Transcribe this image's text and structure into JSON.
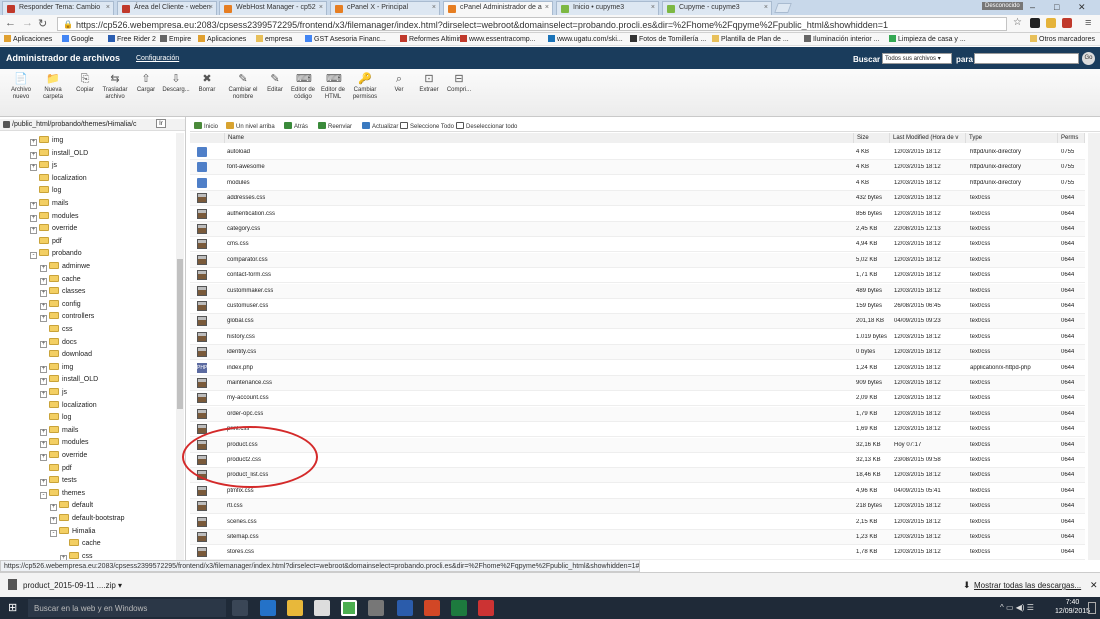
{
  "browser": {
    "tabs": [
      {
        "label": "Responder Tema: Cambio",
        "color": "#c0392b"
      },
      {
        "label": "Área del Cliente - weben",
        "color": "#c0392b"
      },
      {
        "label": "WebHost Manager - cp52",
        "color": "#e67e22"
      },
      {
        "label": "cPanel X - Principal",
        "color": "#e67e22"
      },
      {
        "label": "cPanel Administrador de a",
        "color": "#e67e22"
      },
      {
        "label": "Inicio • cupyme3",
        "color": "#7db843"
      },
      {
        "label": "Cupyme - cupyme3",
        "color": "#7db843"
      }
    ],
    "profile": "Desconocido",
    "url": "https://cp526.webempresa.eu:2083/cpsess2399572295/frontend/x3/filemanager/index.html?dirselect=webroot&domainselect=probando.procli.es&dir=%2Fhome%2Fqpyme%2Fpublic_html&showhidden=1",
    "bookmarks": [
      "Aplicaciones",
      "Google",
      "Free Rider 2",
      "Empire",
      "Aplicaciones",
      "empresa",
      "GST Asesoria Financ...",
      "Reformes Altimira",
      "www.essentracomp...",
      "www.ugatu.com/ski...",
      "Fotos de Tornillería ...",
      "Plantilla de Plan de ...",
      "Iluminación interior ...",
      "Limpieza de casa y ..."
    ],
    "other_bookmarks": "Otros marcadores"
  },
  "fm": {
    "title": "Administrador de archivos",
    "config": "Configuración",
    "search_label": "Buscar",
    "search_scope": "Todos sus archivos",
    "for_label": "para",
    "go": "Go",
    "toolbar": [
      "Archivo nuevo",
      "Nueva carpeta",
      "Copiar",
      "Trasladar archivo",
      "Cargar",
      "Descarg...",
      "Borrar",
      "Cambiar el nombre",
      "Editar",
      "Editor de código",
      "Editor de HTML",
      "Cambiar permisos",
      "Ver",
      "Extraer",
      "Compri..."
    ],
    "path": "/public_html/probando/themes/Himalia/c",
    "path_go": "Ir",
    "nav": [
      "Inicio",
      "Un nivel arriba",
      "Atrás",
      "Reenviar",
      "Actualizar",
      "Seleccione Todo",
      "Deseleccionar todo"
    ],
    "tree": [
      {
        "label": "img",
        "indent": 0,
        "pm": "+"
      },
      {
        "label": "install_OLD",
        "indent": 0,
        "pm": "+"
      },
      {
        "label": "js",
        "indent": 0,
        "pm": "+"
      },
      {
        "label": "localization",
        "indent": 0,
        "pm": ""
      },
      {
        "label": "log",
        "indent": 0,
        "pm": ""
      },
      {
        "label": "mails",
        "indent": 0,
        "pm": "+"
      },
      {
        "label": "modules",
        "indent": 0,
        "pm": "+"
      },
      {
        "label": "override",
        "indent": 0,
        "pm": "+"
      },
      {
        "label": "pdf",
        "indent": 0,
        "pm": ""
      },
      {
        "label": "probando",
        "indent": 0,
        "pm": "-"
      },
      {
        "label": "adminwe",
        "indent": 1,
        "pm": "+"
      },
      {
        "label": "cache",
        "indent": 1,
        "pm": "+"
      },
      {
        "label": "classes",
        "indent": 1,
        "pm": "+"
      },
      {
        "label": "config",
        "indent": 1,
        "pm": "+"
      },
      {
        "label": "controllers",
        "indent": 1,
        "pm": "+"
      },
      {
        "label": "css",
        "indent": 1,
        "pm": ""
      },
      {
        "label": "docs",
        "indent": 1,
        "pm": "+"
      },
      {
        "label": "download",
        "indent": 1,
        "pm": ""
      },
      {
        "label": "img",
        "indent": 1,
        "pm": "+"
      },
      {
        "label": "install_OLD",
        "indent": 1,
        "pm": "+"
      },
      {
        "label": "js",
        "indent": 1,
        "pm": "+"
      },
      {
        "label": "localization",
        "indent": 1,
        "pm": ""
      },
      {
        "label": "log",
        "indent": 1,
        "pm": ""
      },
      {
        "label": "mails",
        "indent": 1,
        "pm": "+"
      },
      {
        "label": "modules",
        "indent": 1,
        "pm": "+"
      },
      {
        "label": "override",
        "indent": 1,
        "pm": "+"
      },
      {
        "label": "pdf",
        "indent": 1,
        "pm": ""
      },
      {
        "label": "tests",
        "indent": 1,
        "pm": "+"
      },
      {
        "label": "themes",
        "indent": 1,
        "pm": "-"
      },
      {
        "label": "default",
        "indent": 2,
        "pm": "+"
      },
      {
        "label": "default-bootstrap",
        "indent": 2,
        "pm": "+"
      },
      {
        "label": "Himalia",
        "indent": 2,
        "pm": "-"
      },
      {
        "label": "cache",
        "indent": 3,
        "pm": ""
      },
      {
        "label": "css",
        "indent": 3,
        "pm": "+"
      }
    ],
    "columns": [
      "Name",
      "Size",
      "Last Modified (Hora de v",
      "Type",
      "Perms"
    ],
    "files": [
      {
        "icon": "dir",
        "name": "autoload",
        "size": "4 KB",
        "modified": "12/03/2015 18:12",
        "type": "httpd/unix-directory",
        "perms": "0755"
      },
      {
        "icon": "dir",
        "name": "font-awesome",
        "size": "4 KB",
        "modified": "12/03/2015 18:12",
        "type": "httpd/unix-directory",
        "perms": "0755"
      },
      {
        "icon": "dir",
        "name": "modules",
        "size": "4 KB",
        "modified": "12/03/2015 18:12",
        "type": "httpd/unix-directory",
        "perms": "0755"
      },
      {
        "icon": "css",
        "name": "addresses.css",
        "size": "432 bytes",
        "modified": "12/03/2015 18:12",
        "type": "text/css",
        "perms": "0644"
      },
      {
        "icon": "css",
        "name": "authentication.css",
        "size": "856 bytes",
        "modified": "12/03/2015 18:12",
        "type": "text/css",
        "perms": "0644"
      },
      {
        "icon": "css",
        "name": "category.css",
        "size": "2,45 KB",
        "modified": "22/08/2015 12:13",
        "type": "text/css",
        "perms": "0644"
      },
      {
        "icon": "css",
        "name": "cms.css",
        "size": "4,94 KB",
        "modified": "12/03/2015 18:12",
        "type": "text/css",
        "perms": "0644"
      },
      {
        "icon": "css",
        "name": "comparator.css",
        "size": "5,02 KB",
        "modified": "12/03/2015 18:12",
        "type": "text/css",
        "perms": "0644"
      },
      {
        "icon": "css",
        "name": "contact-form.css",
        "size": "1,71 KB",
        "modified": "12/03/2015 18:12",
        "type": "text/css",
        "perms": "0644"
      },
      {
        "icon": "css",
        "name": "custommaker.css",
        "size": "489 bytes",
        "modified": "12/03/2015 18:12",
        "type": "text/css",
        "perms": "0644"
      },
      {
        "icon": "css",
        "name": "customuser.css",
        "size": "159 bytes",
        "modified": "26/08/2015 06:45",
        "type": "text/css",
        "perms": "0644"
      },
      {
        "icon": "css",
        "name": "global.css",
        "size": "201,18 KB",
        "modified": "04/09/2015 09:23",
        "type": "text/css",
        "perms": "0644"
      },
      {
        "icon": "css",
        "name": "history.css",
        "size": "1.019 bytes",
        "modified": "12/03/2015 18:12",
        "type": "text/css",
        "perms": "0644"
      },
      {
        "icon": "css",
        "name": "identity.css",
        "size": "0 bytes",
        "modified": "12/03/2015 18:12",
        "type": "text/css",
        "perms": "0644"
      },
      {
        "icon": "php",
        "name": "index.php",
        "size": "1,24 KB",
        "modified": "12/03/2015 18:12",
        "type": "application/x-httpd-php",
        "perms": "0644"
      },
      {
        "icon": "css",
        "name": "maintenance.css",
        "size": "909 bytes",
        "modified": "12/03/2015 18:12",
        "type": "text/css",
        "perms": "0644"
      },
      {
        "icon": "css",
        "name": "my-account.css",
        "size": "2,09 KB",
        "modified": "12/03/2015 18:12",
        "type": "text/css",
        "perms": "0644"
      },
      {
        "icon": "css",
        "name": "order-opc.css",
        "size": "1,79 KB",
        "modified": "12/03/2015 18:12",
        "type": "text/css",
        "perms": "0644"
      },
      {
        "icon": "css",
        "name": "print.css",
        "size": "1,69 KB",
        "modified": "12/03/2015 18:12",
        "type": "text/css",
        "perms": "0644"
      },
      {
        "icon": "css",
        "name": "product.css",
        "size": "32,16 KB",
        "modified": "Hoy 07:17",
        "type": "text/css",
        "perms": "0644"
      },
      {
        "icon": "css",
        "name": "product2.css",
        "size": "32,13 KB",
        "modified": "23/08/2015 09:58",
        "type": "text/css",
        "perms": "0644"
      },
      {
        "icon": "css",
        "name": "product_list.css",
        "size": "18,46 KB",
        "modified": "12/03/2015 18:12",
        "type": "text/css",
        "perms": "0644"
      },
      {
        "icon": "css",
        "name": "ptmfix.css",
        "size": "4,96 KB",
        "modified": "04/09/2015 05:41",
        "type": "text/css",
        "perms": "0644"
      },
      {
        "icon": "css",
        "name": "rtl.css",
        "size": "218 bytes",
        "modified": "12/03/2015 18:12",
        "type": "text/css",
        "perms": "0644"
      },
      {
        "icon": "css",
        "name": "scenes.css",
        "size": "2,15 KB",
        "modified": "12/03/2015 18:12",
        "type": "text/css",
        "perms": "0644"
      },
      {
        "icon": "css",
        "name": "sitemap.css",
        "size": "1,23 KB",
        "modified": "12/03/2015 18:12",
        "type": "text/css",
        "perms": "0644"
      },
      {
        "icon": "css",
        "name": "stores.css",
        "size": "1,78 KB",
        "modified": "12/03/2015 18:12",
        "type": "text/css",
        "perms": "0644"
      }
    ]
  },
  "status_url": "https://cp526.webempresa.eu:2083/cpsess2399572295/frontend/x3/filemanager/index.html?dirselect=webroot&domainselect=probando.procli.es&dir=%2Fhome%2Fqpyme%2Fpublic_html&showhidden=1#",
  "download": {
    "file": "product_2015-09-11 ....zip",
    "show_all": "Mostrar todas las descargas..."
  },
  "taskbar": {
    "search": "Buscar en la web y en Windows",
    "time": "7:40",
    "date": "12/09/2015"
  }
}
